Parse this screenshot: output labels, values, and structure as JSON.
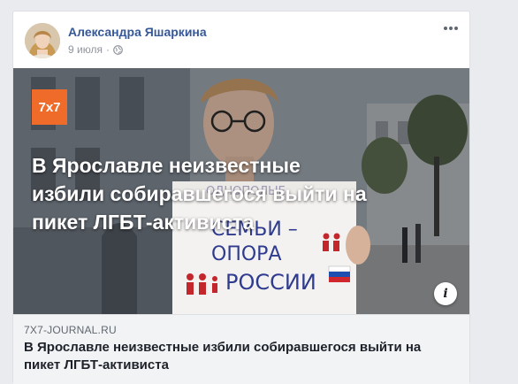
{
  "post": {
    "author_name": "Александра Яшаркина",
    "date": "9 июля",
    "separator": "·",
    "privacy_icon": "globe-icon",
    "more_icon": "more-options-icon"
  },
  "media": {
    "logo_text": "7x7",
    "headline": "В Ярославле неизвестные избили собиравшегося выйти на пикет ЛГБТ-активиста",
    "sign_line1": "СЕМЬИ –",
    "sign_line2": "ОПОРА",
    "sign_line3": "РОССИИ",
    "sign_top": "ОДНОПОЛЫЕ",
    "info_icon_text": "i"
  },
  "link": {
    "domain": "7X7-JOURNAL.RU",
    "title": "В Ярославле неизвестные избили собиравшегося выйти на пикет ЛГБТ-активиста"
  },
  "colors": {
    "author": "#365899",
    "logo_bg": "#ee6b2a",
    "sign_text": "#2f3b8f"
  }
}
